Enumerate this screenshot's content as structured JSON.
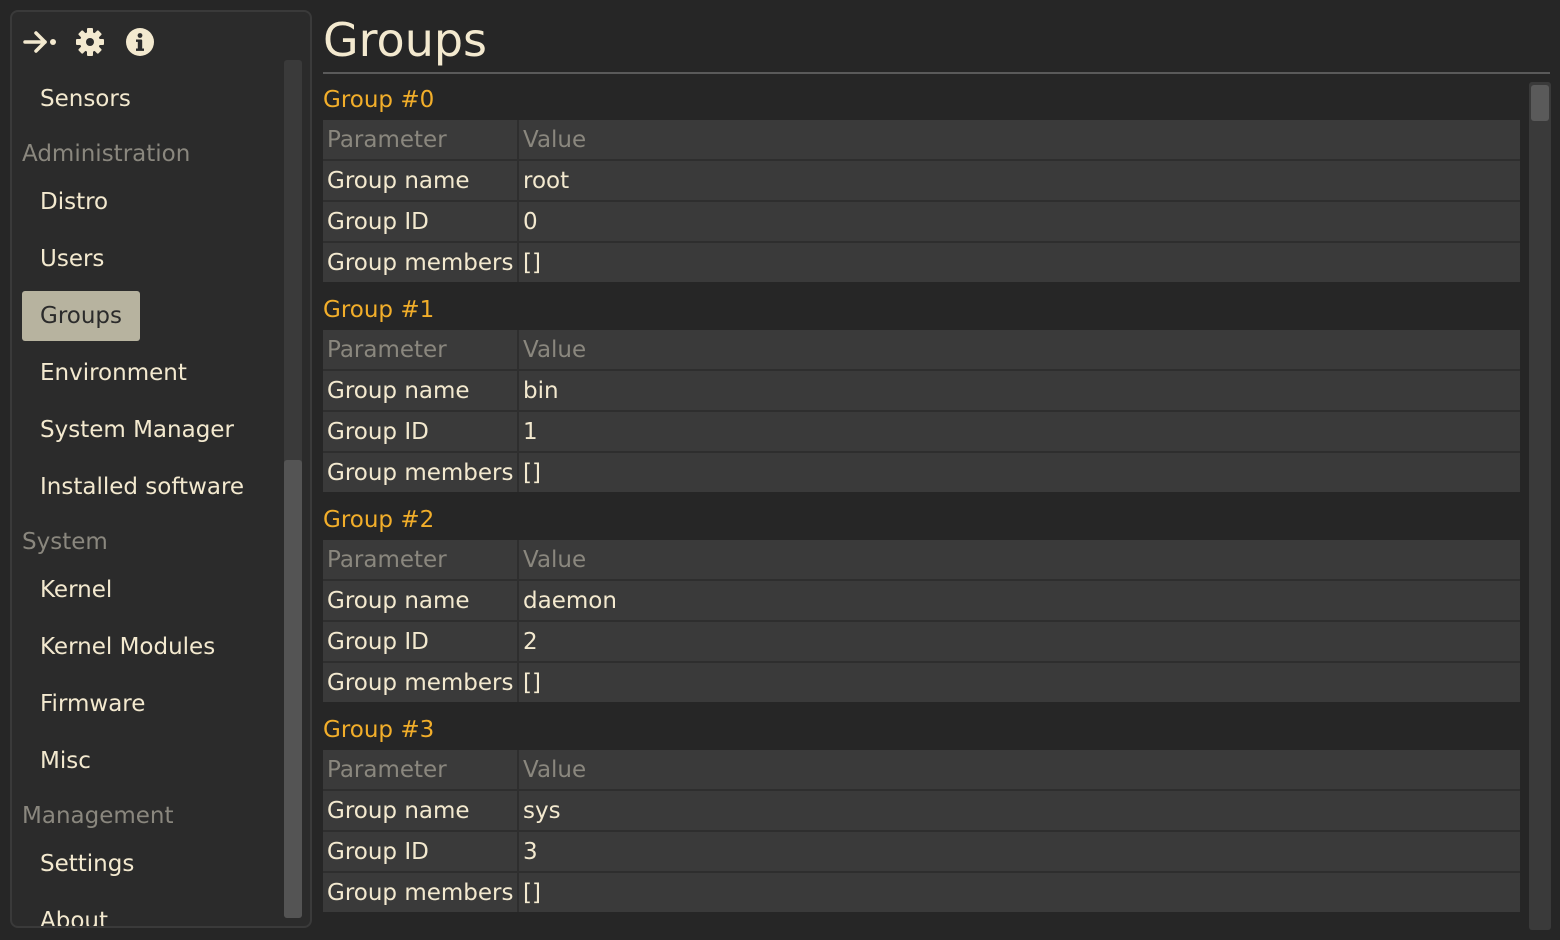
{
  "toolbar": {
    "icons": [
      "collapse-arrow-icon",
      "gear-icon",
      "info-icon"
    ]
  },
  "sidebar": {
    "entries": [
      {
        "type": "item",
        "label": "Sensors"
      },
      {
        "type": "section",
        "label": "Administration"
      },
      {
        "type": "item",
        "label": "Distro"
      },
      {
        "type": "item",
        "label": "Users"
      },
      {
        "type": "item",
        "label": "Groups",
        "active": true
      },
      {
        "type": "item",
        "label": "Environment"
      },
      {
        "type": "item",
        "label": "System Manager"
      },
      {
        "type": "item",
        "label": "Installed software"
      },
      {
        "type": "section",
        "label": "System"
      },
      {
        "type": "item",
        "label": "Kernel"
      },
      {
        "type": "item",
        "label": "Kernel Modules"
      },
      {
        "type": "item",
        "label": "Firmware"
      },
      {
        "type": "item",
        "label": "Misc"
      },
      {
        "type": "section",
        "label": "Management"
      },
      {
        "type": "item",
        "label": "Settings"
      },
      {
        "type": "item",
        "label": "About"
      }
    ]
  },
  "main": {
    "title": "Groups",
    "columns": {
      "parameter": "Parameter",
      "value": "Value"
    },
    "groups": [
      {
        "heading": "Group #0",
        "rows": [
          {
            "param": "Group name",
            "value": "root"
          },
          {
            "param": "Group ID",
            "value": "0"
          },
          {
            "param": "Group members",
            "value": "[]"
          }
        ]
      },
      {
        "heading": "Group #1",
        "rows": [
          {
            "param": "Group name",
            "value": "bin"
          },
          {
            "param": "Group ID",
            "value": "1"
          },
          {
            "param": "Group members",
            "value": "[]"
          }
        ]
      },
      {
        "heading": "Group #2",
        "rows": [
          {
            "param": "Group name",
            "value": "daemon"
          },
          {
            "param": "Group ID",
            "value": "2"
          },
          {
            "param": "Group members",
            "value": "[]"
          }
        ]
      },
      {
        "heading": "Group #3",
        "rows": [
          {
            "param": "Group name",
            "value": "sys"
          },
          {
            "param": "Group ID",
            "value": "3"
          },
          {
            "param": "Group members",
            "value": "[]"
          }
        ]
      }
    ]
  },
  "colors": {
    "background": "#262626",
    "text": "#f3e9cf",
    "accent": "#f2ae2a",
    "muted": "#8a877e",
    "active_item": "#b7b39f",
    "table_bg": "#3a3a3a"
  }
}
